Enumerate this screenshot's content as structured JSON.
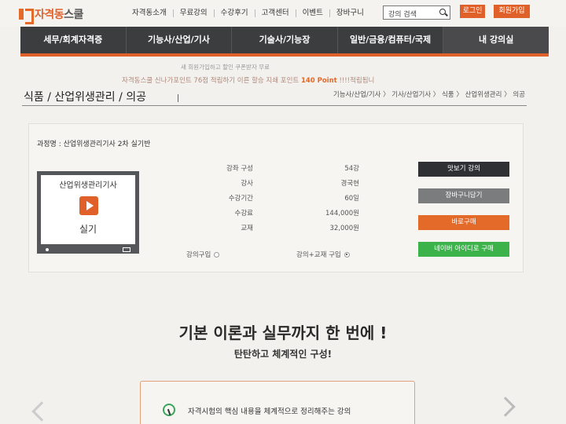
{
  "header": {
    "logo": "자격동스쿨",
    "logo_accent": "자격동",
    "logo_rest": "스쿨",
    "menu": [
      "자격동소개",
      "무료강의",
      "수강후기",
      "고객센터",
      "이벤트",
      "장바구니"
    ],
    "search_placeholder": "강의 검색",
    "login_label": "로그인",
    "join_label": "회원가입"
  },
  "nav": {
    "items": [
      "세무/회계자격증",
      "기능사/산업/기사",
      "기술사/기능장",
      "일반/금융/컴퓨터/국제",
      "내 강의실"
    ],
    "active_index": 4
  },
  "notice": {
    "line1": "새 회원가입하고 할인 쿠폰받자 무료",
    "line2_prefix": "자격동스쿨 신나가포인트 76점 적립하기 이른 할승 지쇄 포인트",
    "line2_highlight": "140 Point",
    "line2_suffix": "!!!!적립됩니"
  },
  "page": {
    "title": "식품 / 산업위생관리 / 의공",
    "breadcrumb": "기능사/산업/기사 〉 기사/산업기사 〉 식품 〉 산업위생관리 〉 의공"
  },
  "course": {
    "name": "과정명 : 산업위생관리기사 2차 실기반",
    "thumbnail_title": "산업위생관리기사",
    "thumbnail_subtitle": "실기",
    "info": [
      {
        "label": "강좌 구성",
        "value": "54강"
      },
      {
        "label": "강사",
        "value": "경국현"
      },
      {
        "label": "수강기간",
        "value": "60일"
      },
      {
        "label": "수강료",
        "value": "144,000원"
      },
      {
        "label": "교재",
        "value": "32,000원"
      }
    ],
    "options": [
      {
        "label": "강의구입",
        "checked": false
      },
      {
        "label": "강의+교재 구입",
        "checked": true
      }
    ],
    "buttons": {
      "preview": "맛보기 강의",
      "cart": "장바구니담기",
      "buy": "바로구매",
      "naver": "네이버 아이디로 구매"
    }
  },
  "promo": {
    "title": "기본 이론과 실무까지 한 번에 !",
    "subtitle": "탄탄하고 체계적인 구성!",
    "feature_text": "자격시험의 핵심 내용을 체계적으로 정리해주는 강의"
  },
  "colors": {
    "accent": "#e0602a",
    "nav_bg": "#3c3d3f",
    "naver_green": "#3bb34a"
  }
}
